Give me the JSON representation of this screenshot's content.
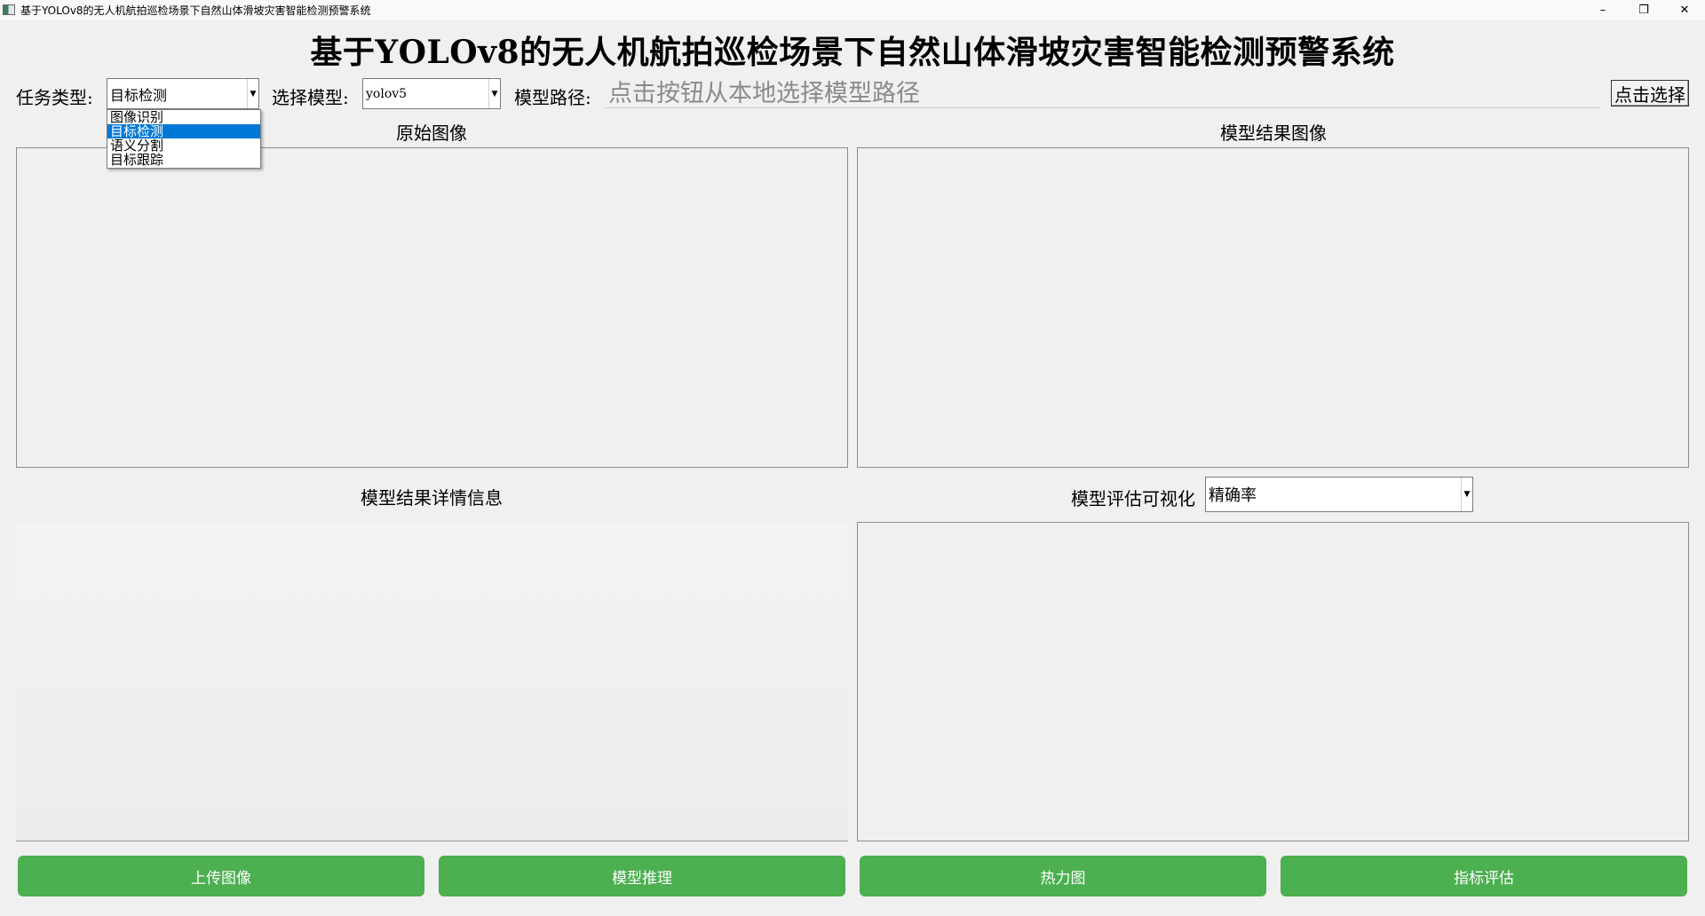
{
  "window": {
    "title": "基于YOLOv8的无人机航拍巡检场景下自然山体滑坡灾害智能检测预警系统",
    "controls": {
      "minimize": "–",
      "restore": "❐",
      "close": "✕"
    }
  },
  "header": {
    "title": "基于YOLOv8的无人机航拍巡检场景下自然山体滑坡灾害智能检测预警系统"
  },
  "toolbar": {
    "task_type_label": "任务类型:",
    "task_type_value": "目标检测",
    "model_label": "选择模型:",
    "model_value": "yolov5",
    "model_path_label": "模型路径:",
    "model_path_placeholder": "点击按钮从本地选择模型路径",
    "select_button": "点击选择"
  },
  "task_dropdown": {
    "options": [
      "图像识别",
      "目标检测",
      "语义分割",
      "目标跟踪"
    ],
    "selected_index": 1
  },
  "panels": {
    "original_image_title": "原始图像",
    "result_image_title": "模型结果图像",
    "result_details_title": "模型结果详情信息",
    "eval_visualization_label": "模型评估可视化",
    "eval_metric_value": "精确率"
  },
  "actions": {
    "upload": "上传图像",
    "inference": "模型推理",
    "heatmap": "热力图",
    "evaluate": "指标评估"
  }
}
